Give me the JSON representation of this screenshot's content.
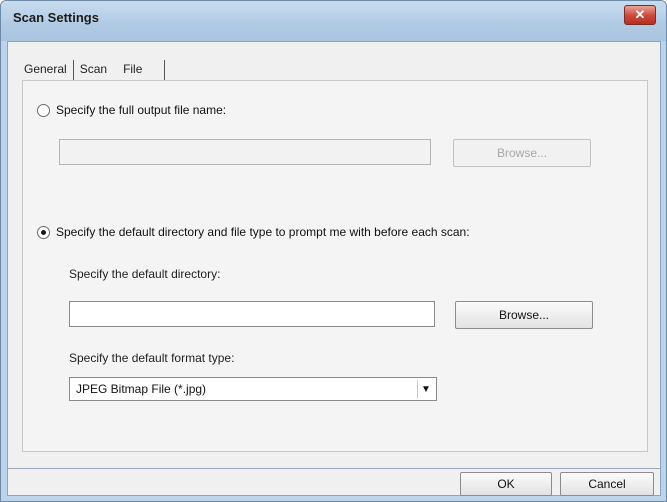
{
  "window": {
    "title": "Scan Settings",
    "close_symbol": "✕"
  },
  "tabs": [
    {
      "label": "General"
    },
    {
      "label": "Scan"
    },
    {
      "label": "File",
      "active": true
    }
  ],
  "output_file": {
    "radio_label": "Specify the full output file name:",
    "selected": false,
    "value": "",
    "browse_label": "Browse..."
  },
  "default_dir": {
    "radio_label": "Specify the default directory and file type to prompt me with before each scan:",
    "selected": true,
    "directory_label": "Specify the default directory:",
    "directory_value": "",
    "browse_label": "Browse...",
    "format_label": "Specify the default format type:",
    "format_value": "JPEG Bitmap File (*.jpg)"
  },
  "footer": {
    "ok_label": "OK",
    "cancel_label": "Cancel"
  }
}
